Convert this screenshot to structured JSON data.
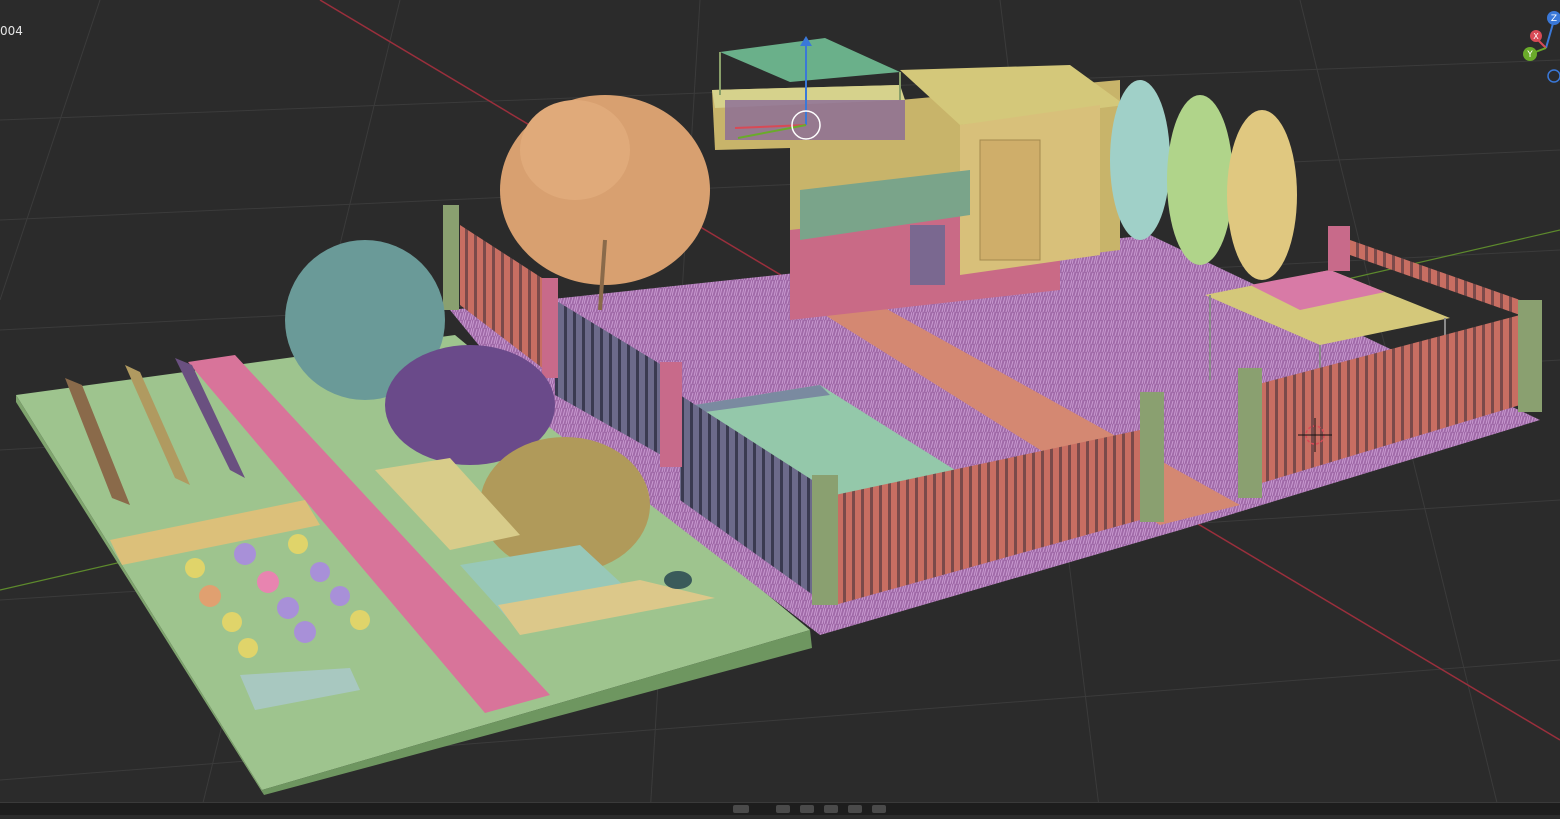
{
  "viewport": {
    "frame_label": "004",
    "background": "#2b2b2b",
    "grid_color": "#3a3a3a",
    "axis_x_color": "#b03040",
    "axis_y_color": "#6a9a30"
  },
  "gizmo": {
    "z_label": "Z",
    "x_label": "X",
    "y_label": "Y",
    "z_color": "#3a78d8",
    "x_color": "#d84a56",
    "y_color": "#6aab2a"
  },
  "scene": {
    "ground_color": "#9cc28a",
    "path_color": "#d8749a",
    "grass_color": "#a873b0",
    "fence_color": "#c87068",
    "house_wall_color": "#c8b46a",
    "house_base_color": "#c86a8a",
    "pool_color": "#8cc6a8"
  }
}
